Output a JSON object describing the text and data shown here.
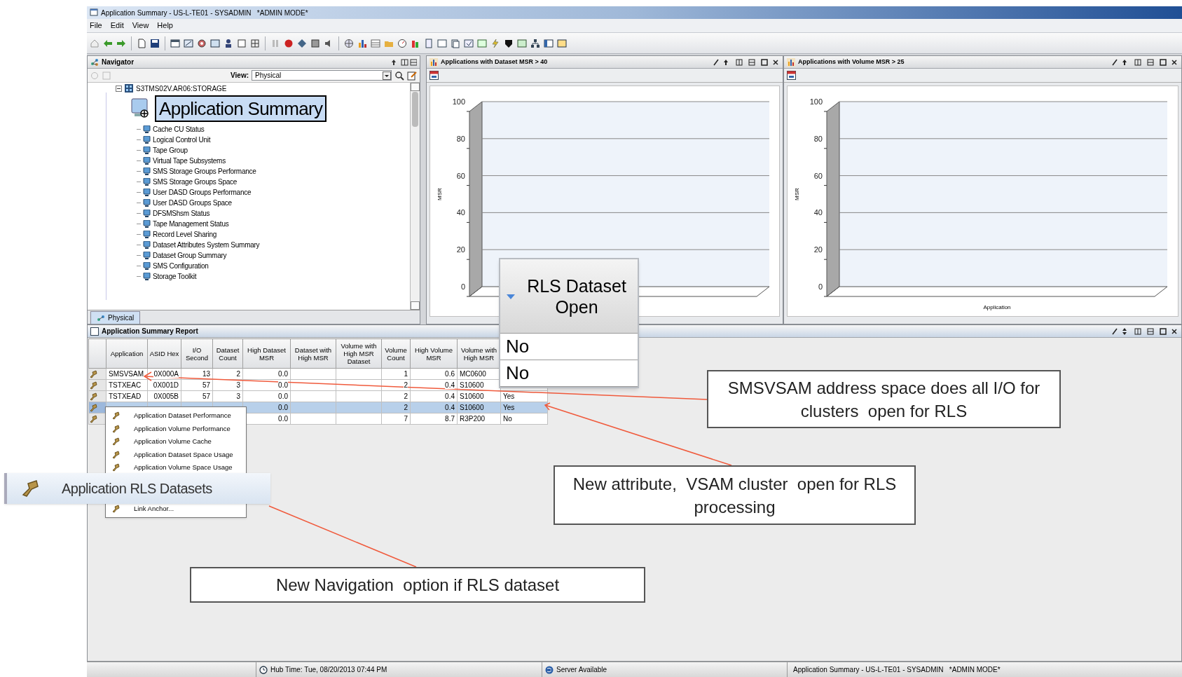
{
  "window": {
    "title": "Application Summary - US-L-TE01 - SYSADMIN   *ADMIN MODE*"
  },
  "menu": [
    "File",
    "Edit",
    "View",
    "Help"
  ],
  "navigator": {
    "title": "Navigator",
    "view_label": "View:",
    "view_value": "Physical",
    "tab": "Physical",
    "tree": {
      "label": "S3TMS02V.AR06:STORAGE",
      "expanded": true,
      "children": [
        {
          "label": "Application Summary",
          "selected": true
        },
        {
          "label": "Cache CU Status",
          "selected": false
        },
        {
          "label": "Logical Control Unit",
          "selected": false
        },
        {
          "label": "Tape Group",
          "selected": false
        },
        {
          "label": "Virtual Tape Subsystems",
          "selected": false
        },
        {
          "label": "SMS Storage Groups Performance",
          "selected": false
        },
        {
          "label": "SMS Storage Groups Space",
          "selected": false
        },
        {
          "label": "User DASD Groups Performance",
          "selected": false
        },
        {
          "label": "User DASD Groups Space",
          "selected": false
        },
        {
          "label": "DFSMShsm Status",
          "selected": false
        },
        {
          "label": "Tape Management Status",
          "selected": false
        },
        {
          "label": "Record Level Sharing",
          "selected": false
        },
        {
          "label": "Dataset Attributes System Summary",
          "selected": false
        },
        {
          "label": "Dataset Group Summary",
          "selected": false
        },
        {
          "label": "SMS Configuration",
          "selected": false
        },
        {
          "label": "Storage Toolkit",
          "selected": false
        }
      ]
    }
  },
  "charts": [
    {
      "title": "Applications with Dataset MSR > 40",
      "chart_data": {
        "type": "bar",
        "grid": true,
        "categories": [
          null
        ],
        "values": [
          null
        ],
        "ylabel": "MSR",
        "ylim": [
          0,
          100
        ],
        "yticks": [
          0,
          20,
          40,
          60,
          80,
          100
        ]
      }
    },
    {
      "title": "Applications with Volume MSR > 25",
      "chart_data": {
        "type": "bar",
        "grid": true,
        "categories": [
          null
        ],
        "values": [
          null
        ],
        "xlabel": "Application",
        "ylabel": "MSR",
        "ylim": [
          0,
          100
        ],
        "yticks": [
          0,
          20,
          40,
          60,
          80,
          100
        ]
      }
    }
  ],
  "report": {
    "title": "Application Summary Report",
    "columns": [
      "Application",
      "ASID Hex",
      "I/O Second",
      "Dataset Count",
      "High Dataset MSR",
      "Dataset with High MSR",
      "Volume with High MSR Dataset",
      "Volume Count",
      "High Volume MSR",
      "Volume with High MSR"
    ],
    "rows": [
      {
        "selected": false,
        "cells": [
          "SMSVSAM",
          "0X000A",
          "13",
          "2",
          "0.0",
          null,
          null,
          "1",
          "0.6",
          "MC0600",
          null
        ]
      },
      {
        "selected": false,
        "cells": [
          "TSTXEAC",
          "0X001D",
          "57",
          "3",
          "0.0",
          null,
          null,
          "2",
          "0.4",
          "S10600",
          null
        ]
      },
      {
        "selected": false,
        "cells": [
          "TSTXEAD",
          "0X005B",
          "57",
          "3",
          "0.0",
          null,
          null,
          "2",
          "0.4",
          "S10600",
          "Yes"
        ]
      },
      {
        "selected": true,
        "cells": [
          null,
          null,
          null,
          null,
          "0.0",
          null,
          null,
          "2",
          "0.4",
          "S10600",
          "Yes"
        ]
      },
      {
        "selected": false,
        "cells": [
          null,
          null,
          null,
          null,
          "0.0",
          null,
          null,
          "7",
          "8.7",
          "R3P200",
          "No"
        ]
      }
    ],
    "rls_popup": {
      "header": "RLS Dataset Open",
      "values": [
        "No",
        "No"
      ]
    },
    "context_menu": [
      {
        "label": "Application Dataset Performance",
        "selected": false
      },
      {
        "label": "Application Volume Performance",
        "selected": false
      },
      {
        "label": "Application Volume Cache",
        "selected": false
      },
      {
        "label": "Application Dataset Space Usage",
        "selected": false
      },
      {
        "label": "Application Volume Space Usage",
        "selected": false
      },
      {
        "label": "Application RLS Datasets",
        "selected": true
      },
      {
        "label": "Link Anchor...",
        "selected": false
      }
    ]
  },
  "callouts": [
    {
      "text": "SMSVSAM address space does all I/O for clusters  open for RLS"
    },
    {
      "text": "New attribute,  VSAM cluster  open for RLS processing"
    },
    {
      "text": "New Navigation  option if RLS dataset"
    }
  ],
  "status_bar": {
    "hub_time": "Hub Time: Tue, 08/20/2013 07:44 PM",
    "server": "Server Available",
    "session": "Application Summary - US-L-TE01 - SYSADMIN   *ADMIN MODE*"
  }
}
